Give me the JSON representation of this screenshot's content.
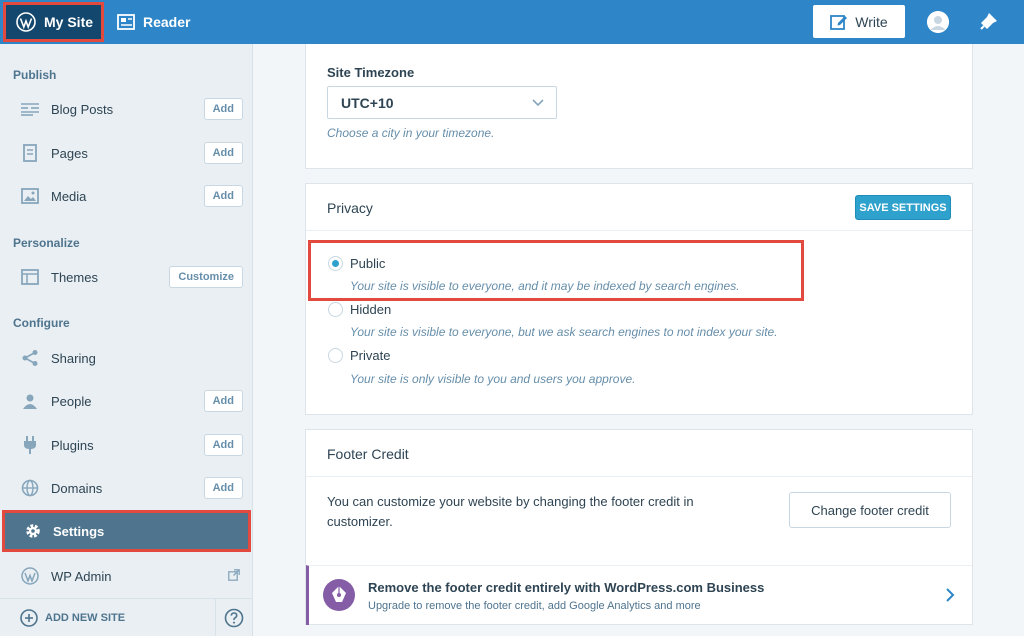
{
  "topbar": {
    "mysite_label": "My Site",
    "reader_label": "Reader",
    "write_label": "Write"
  },
  "sidebar": {
    "sections": [
      {
        "heading": "Publish"
      },
      {
        "heading": "Personalize"
      },
      {
        "heading": "Configure"
      }
    ],
    "items": [
      {
        "label": "Blog Posts",
        "button": "Add"
      },
      {
        "label": "Pages",
        "button": "Add"
      },
      {
        "label": "Media",
        "button": "Add"
      },
      {
        "label": "Themes",
        "button": "Customize"
      },
      {
        "label": "Sharing"
      },
      {
        "label": "People",
        "button": "Add"
      },
      {
        "label": "Plugins",
        "button": "Add"
      },
      {
        "label": "Domains",
        "button": "Add"
      },
      {
        "label": "Settings",
        "active": true
      },
      {
        "label": "WP Admin"
      }
    ],
    "footer": {
      "add_site_label": "ADD NEW SITE"
    }
  },
  "timezone": {
    "label": "Site Timezone",
    "value": "UTC+10",
    "help": "Choose a city in your timezone."
  },
  "privacy": {
    "title": "Privacy",
    "save_label": "SAVE SETTINGS",
    "options": [
      {
        "label": "Public",
        "description": "Your site is visible to everyone, and it may be indexed by search engines.",
        "checked": true
      },
      {
        "label": "Hidden",
        "description": "Your site is visible to everyone, but we ask search engines to not index your site.",
        "checked": false
      },
      {
        "label": "Private",
        "description": "Your site is only visible to you and users you approve.",
        "checked": false
      }
    ]
  },
  "footer_credit": {
    "title": "Footer Credit",
    "text": "You can customize your website by changing the footer credit in customizer.",
    "button_label": "Change footer credit",
    "upsell_title": "Remove the footer credit entirely with WordPress.com Business",
    "upsell_desc": "Upgrade to remove the footer credit, add Google Analytics and more"
  },
  "colors": {
    "topbar": "#2e86c8",
    "sidebar_bg": "#e9eff3",
    "active_item": "#4f748e",
    "accent": "#2ea2cc",
    "highlight": "#e2493f",
    "upsell": "#855da6"
  }
}
